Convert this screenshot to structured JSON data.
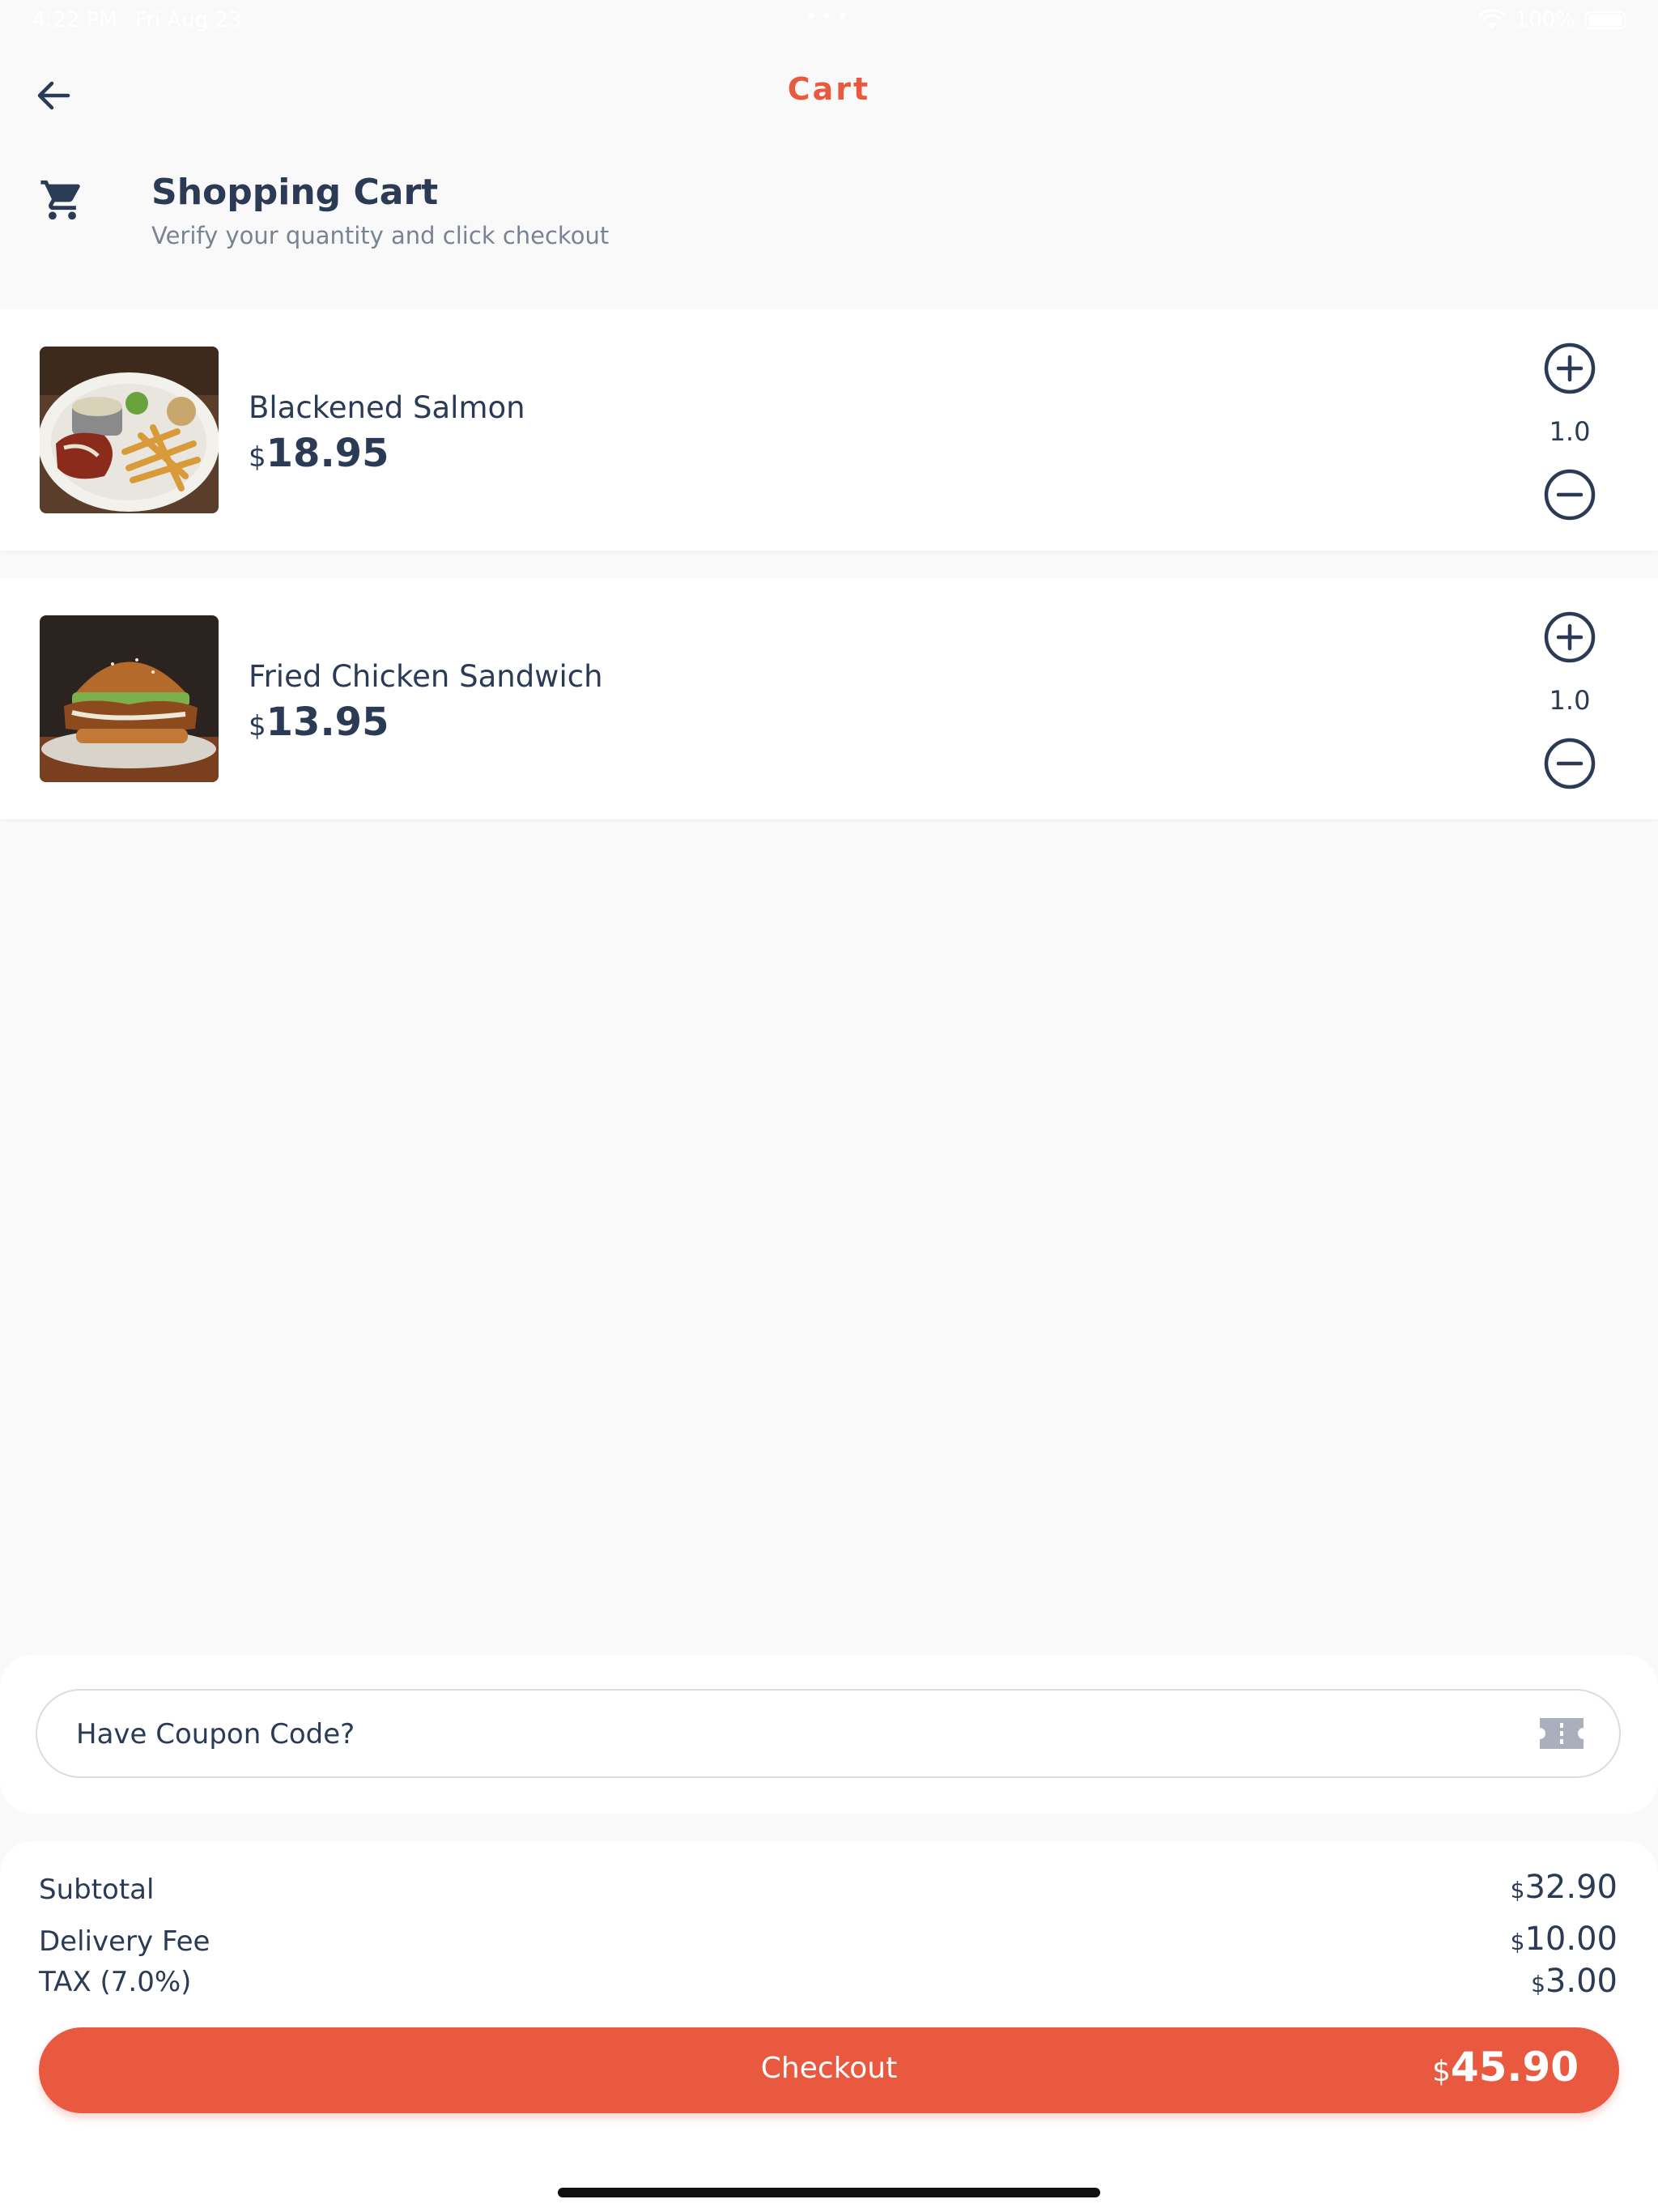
{
  "status_bar": {
    "time": "4:22 PM",
    "date": "Fri Aug 23",
    "battery": "100%",
    "dots": "•••"
  },
  "nav": {
    "title": "Cart",
    "back_icon": "arrow-left-icon"
  },
  "header": {
    "icon": "shopping-cart-icon",
    "title": "Shopping Cart",
    "subtitle": "Verify your quantity and click checkout"
  },
  "items": [
    {
      "name": "Blackened Salmon",
      "currency": "$",
      "price": "18.95",
      "quantity": "1.0"
    },
    {
      "name": "Fried Chicken Sandwich",
      "currency": "$",
      "price": "13.95",
      "quantity": "1.0"
    }
  ],
  "coupon": {
    "placeholder": "Have Coupon Code?",
    "icon": "ticket-icon"
  },
  "summary": {
    "subtotal_label": "Subtotal",
    "subtotal_currency": "$",
    "subtotal_value": "32.90",
    "delivery_label": "Delivery Fee",
    "delivery_currency": "$",
    "delivery_value": "10.00",
    "tax_label": "TAX (7.0%)",
    "tax_currency": "$",
    "tax_value": "3.00"
  },
  "checkout": {
    "label": "Checkout",
    "currency": "$",
    "total": "45.90"
  },
  "colors": {
    "accent": "#e8593f",
    "text": "#2b3a55",
    "muted": "#7a8394",
    "background": "#f9f9f9"
  }
}
